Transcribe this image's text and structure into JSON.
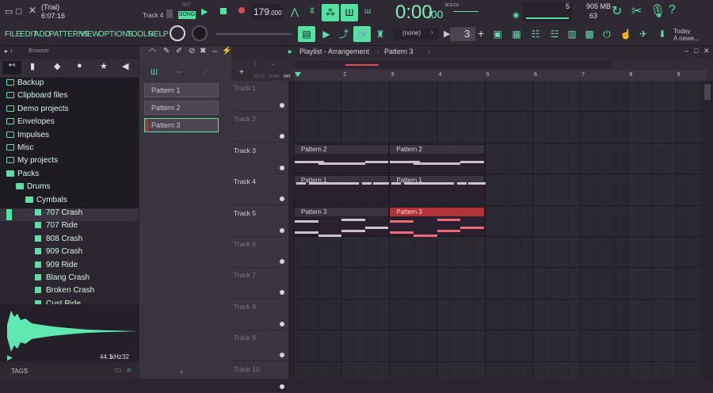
{
  "window": {
    "trial": "(Trial)",
    "clock": "6:07:16",
    "track_hint": "Track 4",
    "pat_label": "PAT",
    "song_label": "SONG",
    "tempo": "179",
    "tempo_frac": ".000",
    "time": "0:00",
    "time_frac": ":00",
    "time_unit": "M:S:CS",
    "cpu_count": "5",
    "memory": "905 MB",
    "poly": "63",
    "news_title": "Today",
    "news_body": "A newe..."
  },
  "menu": [
    "FILE",
    "EDIT",
    "ADD",
    "PATTERNS",
    "VIEW",
    "OPTIONS",
    "TOOLS",
    "HELP"
  ],
  "toolbar": {
    "pattern_selector": "(none)",
    "step_value": "3"
  },
  "browser": {
    "title": "Browser",
    "items": [
      {
        "label": "Backup",
        "type": "folder",
        "indent": 0
      },
      {
        "label": "Clipboard files",
        "type": "folder",
        "indent": 0
      },
      {
        "label": "Demo projects",
        "type": "folder",
        "indent": 0
      },
      {
        "label": "Envelopes",
        "type": "folder",
        "indent": 0
      },
      {
        "label": "Impulses",
        "type": "folder",
        "indent": 0
      },
      {
        "label": "Misc",
        "type": "folder",
        "indent": 0
      },
      {
        "label": "My projects",
        "type": "folder",
        "indent": 0
      },
      {
        "label": "Packs",
        "type": "open",
        "indent": 0
      },
      {
        "label": "Drums",
        "type": "open",
        "indent": 1
      },
      {
        "label": "Cymbals",
        "type": "open",
        "indent": 2
      },
      {
        "label": "707 Crash",
        "type": "sound",
        "indent": 3,
        "selected": true
      },
      {
        "label": "707 Ride",
        "type": "sound",
        "indent": 3
      },
      {
        "label": "808 Crash",
        "type": "sound",
        "indent": 3
      },
      {
        "label": "909 Crash",
        "type": "sound",
        "indent": 3
      },
      {
        "label": "909 Ride",
        "type": "sound",
        "indent": 3
      },
      {
        "label": "Blang Crash",
        "type": "sound",
        "indent": 3
      },
      {
        "label": "Broken Crash",
        "type": "sound",
        "indent": 3
      },
      {
        "label": "Cust Ride",
        "type": "sound",
        "indent": 3
      }
    ],
    "sample_rate": "44.1",
    "sample_rate_unit": "kHz",
    "bit_depth": "32",
    "tags_label": "TAGS"
  },
  "picker": {
    "patterns": [
      "Pattern 1",
      "Pattern 2",
      "Pattern 3"
    ]
  },
  "playlist": {
    "title": "Playlist - Arrangement",
    "crumb": "Pattern 3",
    "tools": [
      "NOTE",
      "SHAR",
      "PAT"
    ],
    "bars": [
      "1",
      "2",
      "3",
      "4",
      "5",
      "6",
      "7",
      "8",
      "9"
    ],
    "tracks": [
      "Track 1",
      "Track 2",
      "Track 3",
      "Track 4",
      "Track 5",
      "Track 6",
      "Track 7",
      "Track 8",
      "Track 9",
      "Track 10"
    ],
    "clips": [
      {
        "label": "Pattern 2",
        "track": 2,
        "bar": 1
      },
      {
        "label": "Pattern 2",
        "track": 2,
        "bar": 3
      },
      {
        "label": "Pattern 1",
        "track": 3,
        "bar": 1
      },
      {
        "label": "Pattern 1",
        "track": 3,
        "bar": 3
      },
      {
        "label": "Pattern 3",
        "track": 4,
        "bar": 1
      },
      {
        "label": "Pattern 3",
        "track": 4,
        "bar": 3,
        "selected": true
      }
    ]
  },
  "colors": {
    "accent": "#54e2a0",
    "selected_clip": "#b23239",
    "background": "#2a2530"
  }
}
